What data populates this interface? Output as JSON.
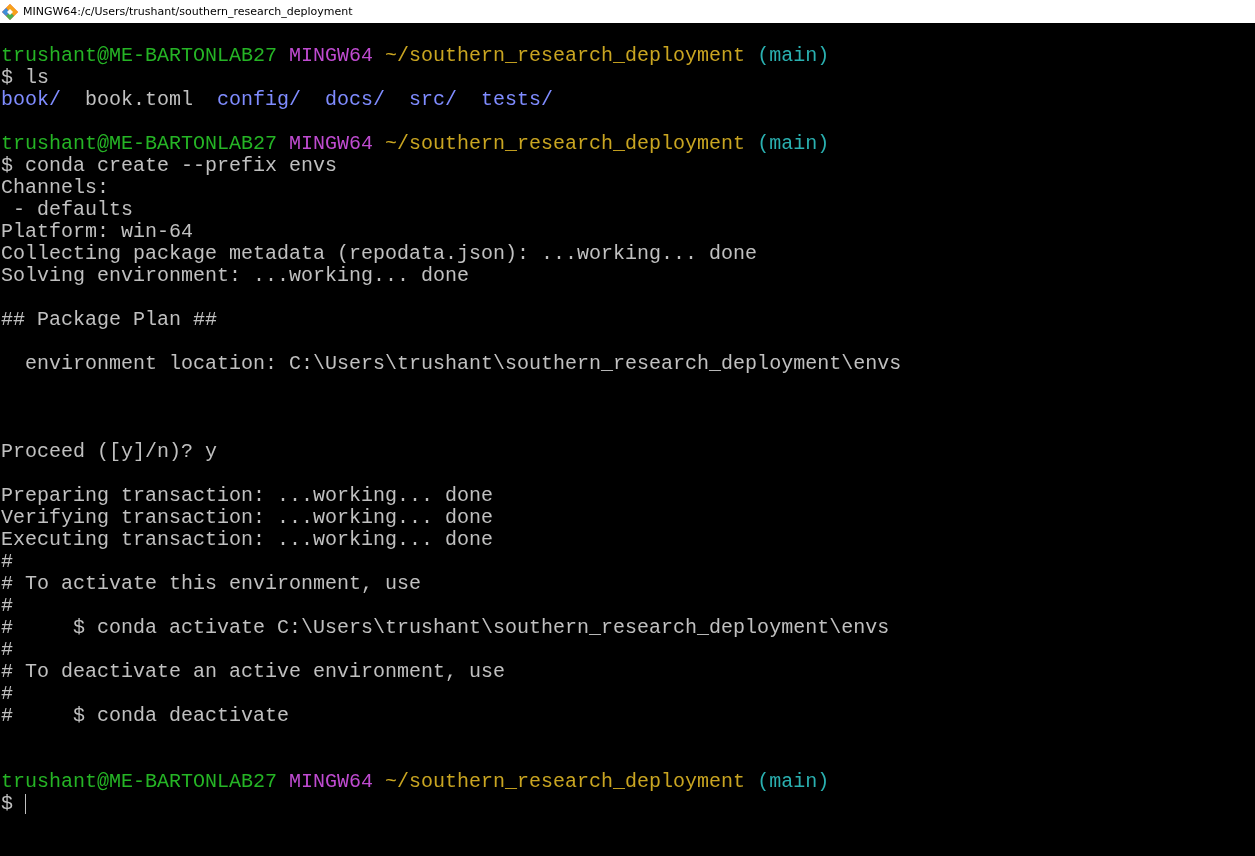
{
  "window": {
    "title": "MINGW64:/c/Users/trushant/southern_research_deployment"
  },
  "terminal": {
    "lines": [
      {
        "kind": "blank"
      },
      {
        "kind": "prompt",
        "user_host": "trushant@ME-BARTONLAB27",
        "system": "MINGW64",
        "path": "~/southern_research_deployment",
        "branch": "(main)"
      },
      {
        "kind": "command",
        "symbol": "$",
        "text": "ls"
      },
      {
        "kind": "listing",
        "entries": [
          {
            "name": "book/",
            "kind": "dir"
          },
          {
            "name": "book.toml",
            "kind": "file"
          },
          {
            "name": "config/",
            "kind": "dir"
          },
          {
            "name": "docs/",
            "kind": "dir"
          },
          {
            "name": "src/",
            "kind": "dir"
          },
          {
            "name": "tests/",
            "kind": "dir"
          }
        ]
      },
      {
        "kind": "blank"
      },
      {
        "kind": "prompt",
        "user_host": "trushant@ME-BARTONLAB27",
        "system": "MINGW64",
        "path": "~/southern_research_deployment",
        "branch": "(main)"
      },
      {
        "kind": "command",
        "symbol": "$",
        "text": "conda create --prefix envs"
      },
      {
        "kind": "output",
        "text": "Channels:"
      },
      {
        "kind": "output",
        "text": " - defaults"
      },
      {
        "kind": "output",
        "text": "Platform: win-64"
      },
      {
        "kind": "output",
        "text": "Collecting package metadata (repodata.json): ...working... done"
      },
      {
        "kind": "output",
        "text": "Solving environment: ...working... done"
      },
      {
        "kind": "blank"
      },
      {
        "kind": "output",
        "text": "## Package Plan ##"
      },
      {
        "kind": "blank"
      },
      {
        "kind": "output",
        "text": "  environment location: C:\\Users\\trushant\\southern_research_deployment\\envs"
      },
      {
        "kind": "blank"
      },
      {
        "kind": "blank"
      },
      {
        "kind": "blank"
      },
      {
        "kind": "output",
        "text": "Proceed ([y]/n)? y"
      },
      {
        "kind": "blank"
      },
      {
        "kind": "output",
        "text": "Preparing transaction: ...working... done"
      },
      {
        "kind": "output",
        "text": "Verifying transaction: ...working... done"
      },
      {
        "kind": "output",
        "text": "Executing transaction: ...working... done"
      },
      {
        "kind": "output",
        "text": "#"
      },
      {
        "kind": "output",
        "text": "# To activate this environment, use"
      },
      {
        "kind": "output",
        "text": "#"
      },
      {
        "kind": "output",
        "text": "#     $ conda activate C:\\Users\\trushant\\southern_research_deployment\\envs"
      },
      {
        "kind": "output",
        "text": "#"
      },
      {
        "kind": "output",
        "text": "# To deactivate an active environment, use"
      },
      {
        "kind": "output",
        "text": "#"
      },
      {
        "kind": "output",
        "text": "#     $ conda deactivate"
      },
      {
        "kind": "blank"
      },
      {
        "kind": "blank"
      },
      {
        "kind": "prompt",
        "user_host": "trushant@ME-BARTONLAB27",
        "system": "MINGW64",
        "path": "~/southern_research_deployment",
        "branch": "(main)"
      },
      {
        "kind": "input",
        "symbol": "$",
        "cursor": true
      }
    ]
  }
}
